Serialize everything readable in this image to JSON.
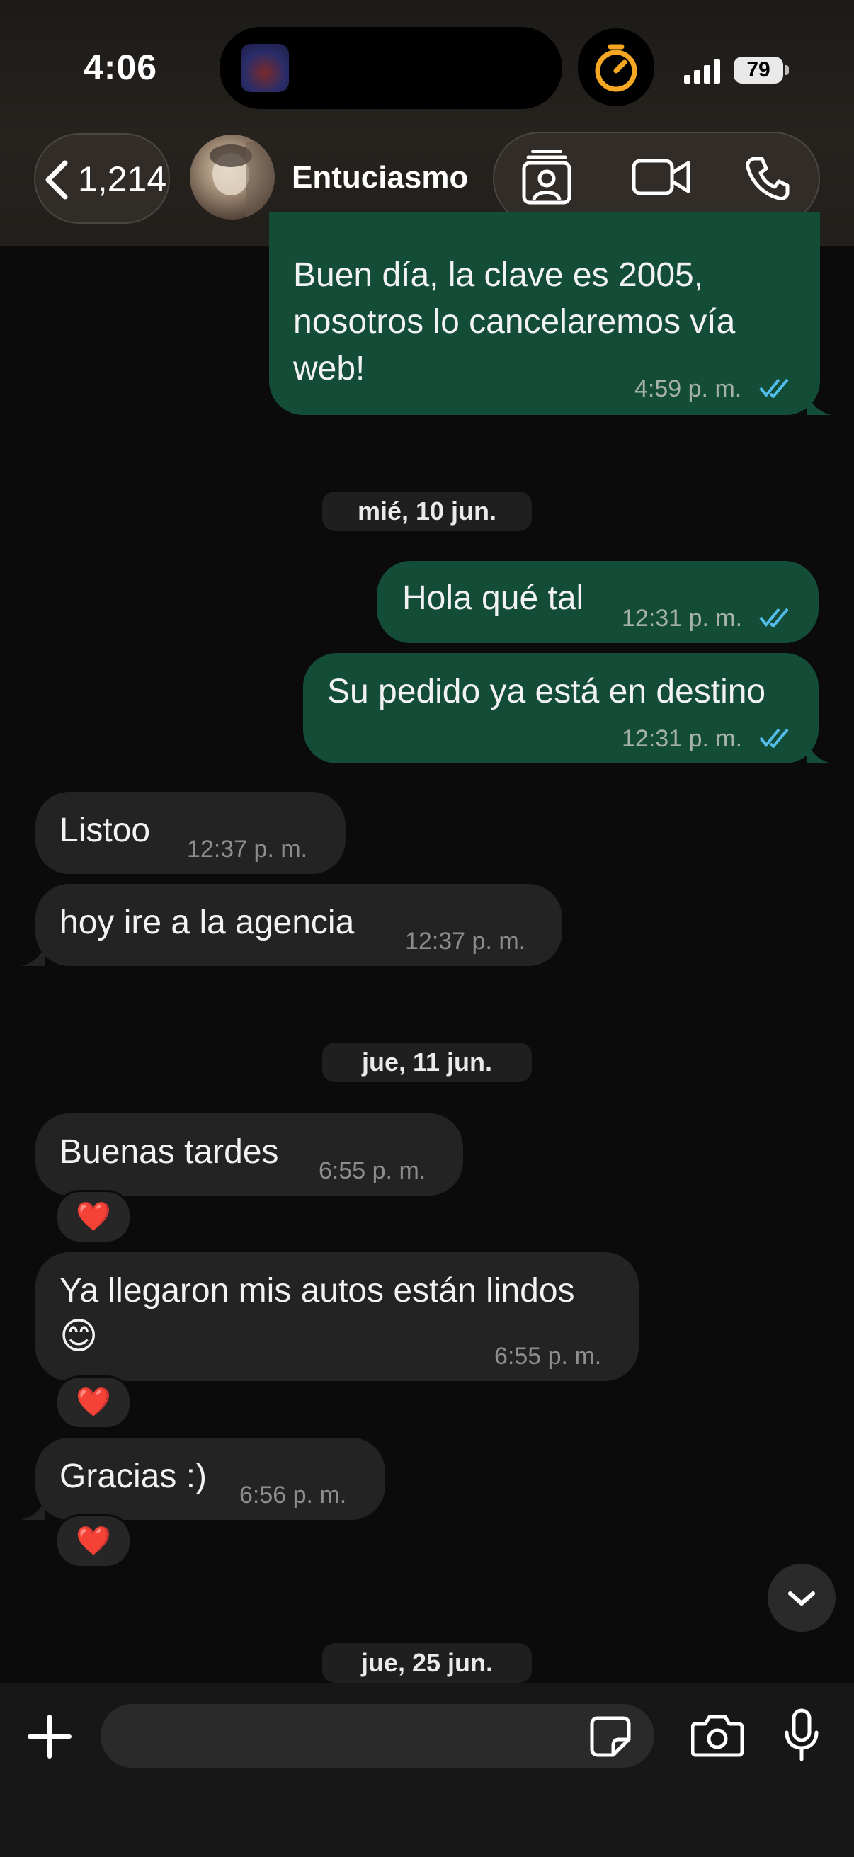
{
  "status_bar": {
    "time": "4:06",
    "battery": "79"
  },
  "header": {
    "back_count": "1,214",
    "contact_name": "Entuciasmo"
  },
  "messages": [
    {
      "text_lines": [
        "Buen día, la clave es 2005,",
        "nosotros lo cancelaremos vía",
        "web!"
      ],
      "time": "4:59",
      "suffix": "p. m."
    },
    {
      "text": "Hola qué tal",
      "time": "12:31",
      "suffix": "p. m."
    },
    {
      "text": "Su pedido ya está en destino",
      "time": "12:31",
      "suffix": "p. m."
    },
    {
      "text": "Listoo",
      "time": "12:37",
      "suffix": "p. m."
    },
    {
      "text": "hoy ire  a la agencia",
      "time": "12:37",
      "suffix": "p. m."
    },
    {
      "text": "Buenas tardes",
      "time": "6:55",
      "suffix": "p. m.",
      "reaction": "❤️"
    },
    {
      "text": "Ya llegaron mis autos están lindos",
      "emoji": "😊",
      "time": "6:55",
      "suffix": "p. m.",
      "reaction": "❤️"
    },
    {
      "text": "Gracias :)",
      "time": "6:56",
      "suffix": "p. m.",
      "reaction": "❤️"
    }
  ],
  "dates": [
    "mié, 10 jun.",
    "jue, 11 jun.",
    "jue, 25 jun."
  ],
  "composer": {
    "placeholder": ""
  },
  "colors": {
    "outgoing": "#134d37",
    "incoming": "#232323",
    "read_ticks": "#53bdeb",
    "timer": "#f5a623"
  },
  "icons": [
    "back-chevron-icon",
    "contact-card-icon",
    "video-call-icon",
    "phone-icon",
    "plus-icon",
    "sticker-icon",
    "camera-icon",
    "microphone-icon",
    "chevron-down-icon",
    "timer-icon",
    "signal-icon"
  ]
}
